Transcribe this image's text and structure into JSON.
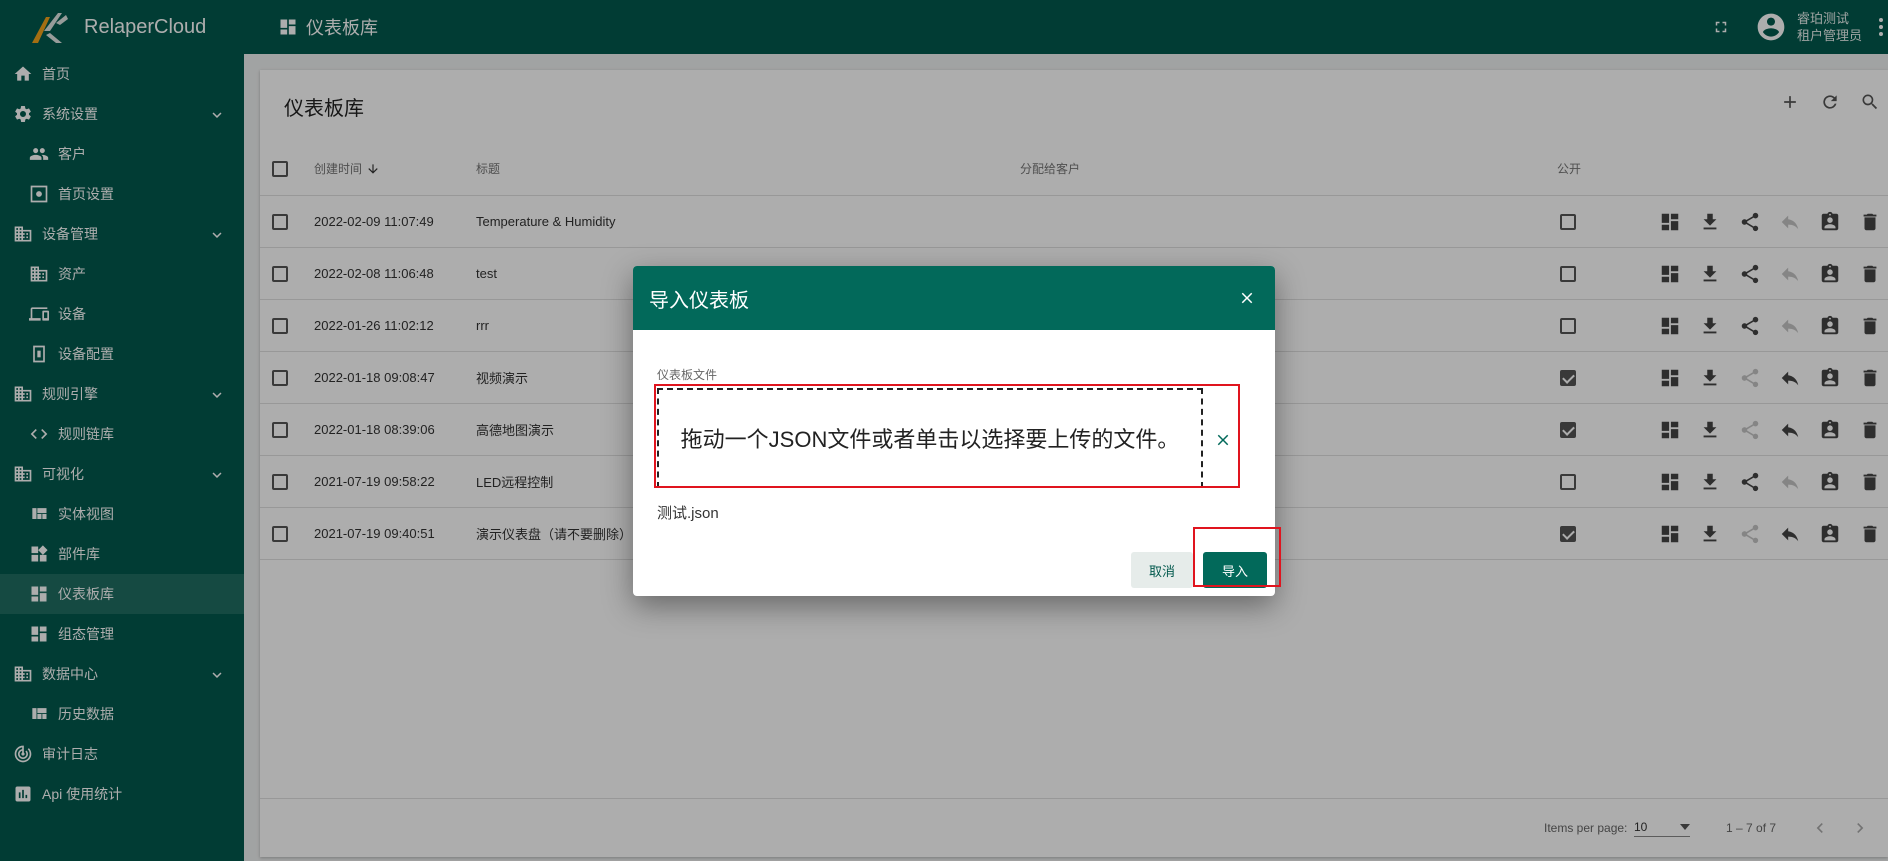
{
  "app": {
    "brand": "RelaperCloud"
  },
  "topbar": {
    "title": "仪表板库",
    "user_name": "睿珀测试",
    "user_role": "租户管理员",
    "icons": [
      "dashboard-icon",
      "fullscreen-icon",
      "account-icon",
      "more-vert-icon"
    ]
  },
  "sidebar": {
    "items": [
      {
        "label": "首页",
        "icon": "home-icon",
        "level": "top"
      },
      {
        "label": "系统设置",
        "icon": "gear-icon",
        "level": "top",
        "expandable": true
      },
      {
        "label": "客户",
        "icon": "people-icon",
        "level": "sub"
      },
      {
        "label": "首页设置",
        "icon": "settings-box-icon",
        "level": "sub"
      },
      {
        "label": "设备管理",
        "icon": "building-icon",
        "level": "top",
        "expandable": true
      },
      {
        "label": "资产",
        "icon": "building-icon",
        "level": "sub"
      },
      {
        "label": "设备",
        "icon": "device-icon",
        "level": "sub"
      },
      {
        "label": "设备配置",
        "icon": "device-profile-icon",
        "level": "sub"
      },
      {
        "label": "规则引擎",
        "icon": "building-icon",
        "level": "top",
        "expandable": true
      },
      {
        "label": "规则链库",
        "icon": "code-icon",
        "level": "sub"
      },
      {
        "label": "可视化",
        "icon": "building-icon",
        "level": "top",
        "expandable": true
      },
      {
        "label": "实体视图",
        "icon": "view-quilt-icon",
        "level": "sub"
      },
      {
        "label": "部件库",
        "icon": "widgets-icon",
        "level": "sub"
      },
      {
        "label": "仪表板库",
        "icon": "dashboard-icon",
        "level": "sub",
        "active": true
      },
      {
        "label": "组态管理",
        "icon": "dashboard-icon",
        "level": "sub"
      },
      {
        "label": "数据中心",
        "icon": "building-icon",
        "level": "top",
        "expandable": true
      },
      {
        "label": "历史数据",
        "icon": "view-quilt-icon",
        "level": "sub"
      },
      {
        "label": "审计日志",
        "icon": "track-changes-icon",
        "level": "top"
      },
      {
        "label": "Api 使用统计",
        "icon": "bar-chart-icon",
        "level": "top"
      }
    ]
  },
  "main": {
    "title": "仪表板库",
    "columns": {
      "created": "创建时间",
      "title": "标题",
      "assigned": "分配给客户",
      "public": "公开"
    },
    "rows": [
      {
        "created": "2022-02-09 11:07:49",
        "title": "Temperature & Humidity",
        "public": false
      },
      {
        "created": "2022-02-08 11:06:48",
        "title": "test",
        "public": false
      },
      {
        "created": "2022-01-26 11:02:12",
        "title": "rrr",
        "public": false
      },
      {
        "created": "2022-01-18 09:08:47",
        "title": "视频演示",
        "public": true
      },
      {
        "created": "2022-01-18 08:39:06",
        "title": "高德地图演示",
        "public": true
      },
      {
        "created": "2021-07-19 09:58:22",
        "title": "LED远程控制",
        "public": false
      },
      {
        "created": "2021-07-19 09:40:51",
        "title": "演示仪表盘（请不要删除）",
        "public": true
      }
    ],
    "footer": {
      "items_per_page_label": "Items per page:",
      "items_per_page": "10",
      "range": "1 – 7 of 7"
    }
  },
  "dialog": {
    "title": "导入仪表板",
    "field_label": "仪表板文件",
    "dropzone_text": "拖动一个JSON文件或者单击以选择要上传的文件。",
    "filename": "测试.json",
    "cancel": "取消",
    "import": "导入"
  },
  "colors": {
    "primary": "#02594d",
    "header": "#02695a",
    "highlight": "#e0141e"
  }
}
